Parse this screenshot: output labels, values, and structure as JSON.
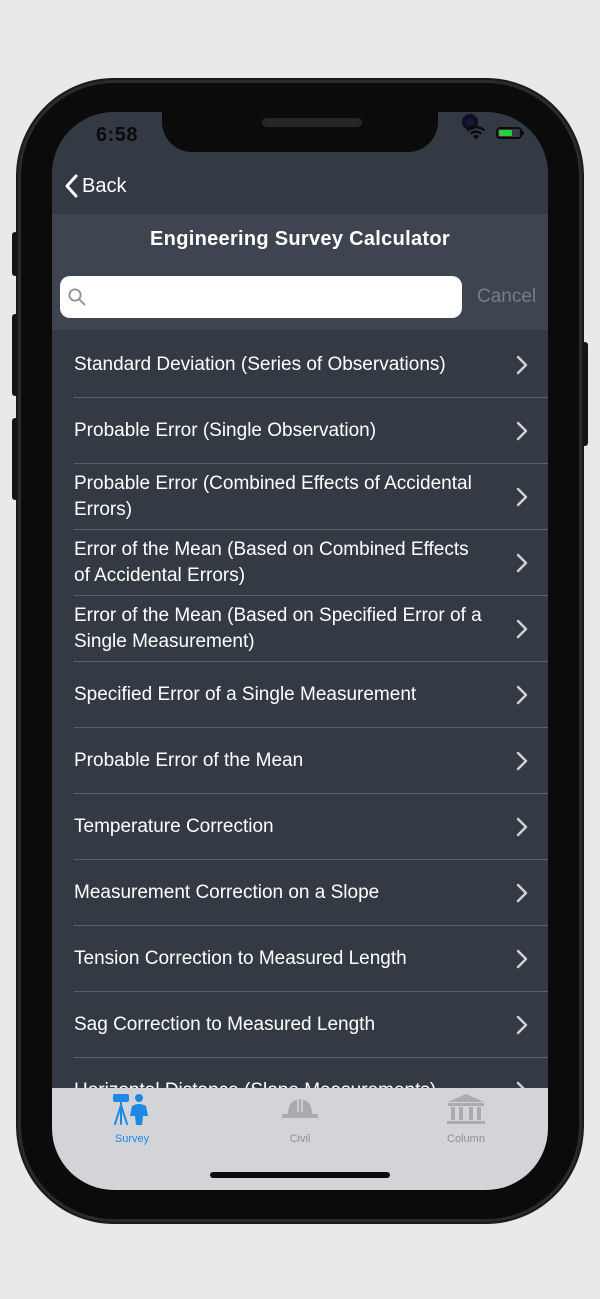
{
  "status_bar": {
    "time": "6:58"
  },
  "nav": {
    "back_label": "Back",
    "title": "Engineering Survey Calculator"
  },
  "search": {
    "value": "",
    "placeholder": "",
    "cancel_label": "Cancel"
  },
  "list": {
    "items": [
      {
        "label": "Standard Deviation (Series of Observations)"
      },
      {
        "label": "Probable Error (Single Observation)"
      },
      {
        "label": "Probable Error (Combined Effects of Accidental Errors)"
      },
      {
        "label": "Error of the Mean (Based on Combined Effects of Accidental Errors)"
      },
      {
        "label": "Error of the Mean (Based on Specified Error of a Single Measurement)"
      },
      {
        "label": "Specified Error of a Single Measurement"
      },
      {
        "label": "Probable Error of the Mean"
      },
      {
        "label": "Temperature Correction"
      },
      {
        "label": "Measurement Correction on a Slope"
      },
      {
        "label": "Tension Correction to Measured Length"
      },
      {
        "label": "Sag Correction to Measured Length"
      },
      {
        "label": "Horizontal Distance (Slope Measurements)"
      }
    ]
  },
  "tabs": [
    {
      "label": "Survey",
      "icon": "surveyor-icon",
      "active": true
    },
    {
      "label": "Civil",
      "icon": "hard-hat-icon",
      "active": false
    },
    {
      "label": "Column",
      "icon": "column-building-icon",
      "active": false
    }
  ],
  "colors": {
    "accent": "#1e88e5",
    "background": "#343a44",
    "header": "#3e4450",
    "tab_bar": "#d3d4d7",
    "inactive_tab": "#8e9096"
  }
}
